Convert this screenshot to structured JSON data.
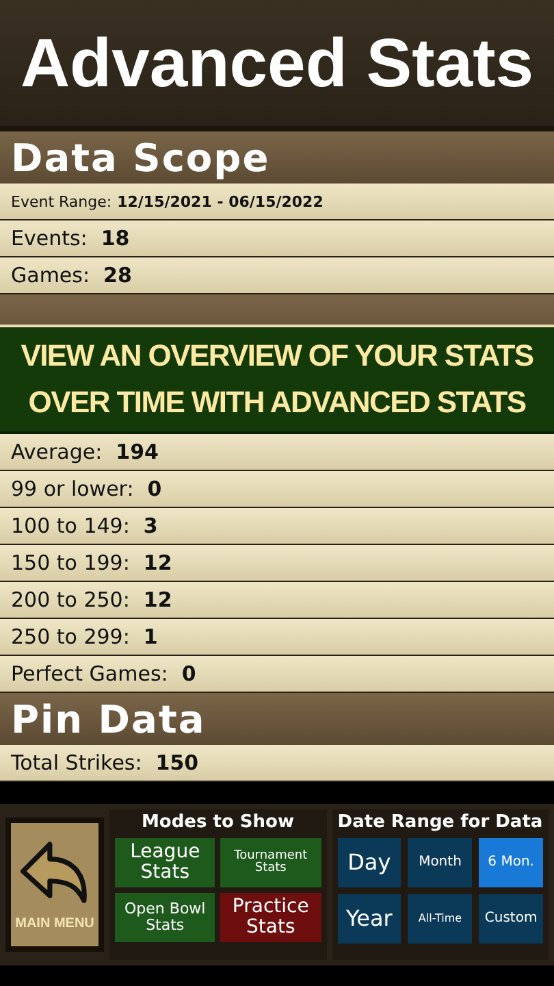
{
  "title": "Advanced Stats",
  "sections": [
    {
      "header": "Data Scope",
      "rows": [
        {
          "label": "Event Range:",
          "value": "12/15/2021 - 06/15/2022",
          "kind": "small"
        },
        {
          "label": "Events:",
          "value": "18",
          "kind": "normal"
        },
        {
          "label": "Games:",
          "value": "28",
          "kind": "normal"
        }
      ]
    },
    {
      "rows": [
        {
          "label": "Average:",
          "value": "194",
          "kind": "normal"
        },
        {
          "label": "99 or lower:",
          "value": "0",
          "kind": "normal"
        },
        {
          "label": "100 to 149:",
          "value": "3",
          "kind": "normal"
        },
        {
          "label": "150 to 199:",
          "value": "12",
          "kind": "normal"
        },
        {
          "label": "200 to 250:",
          "value": "12",
          "kind": "normal"
        },
        {
          "label": "250 to 299:",
          "value": "1",
          "kind": "normal"
        },
        {
          "label": "Perfect Games:",
          "value": "0",
          "kind": "normal"
        }
      ]
    },
    {
      "header": "Pin Data",
      "rows": [
        {
          "label": "Total Strikes:",
          "value": "150",
          "kind": "normal"
        }
      ]
    }
  ],
  "banner": [
    "VIEW AN OVERVIEW OF YOUR STATS",
    "OVER TIME WITH ADVANCED STATS"
  ],
  "main_menu": {
    "label": "MAIN MENU"
  },
  "modes": {
    "title": "Modes to Show",
    "items": [
      {
        "label": "League Stats",
        "on": true,
        "kind": "large"
      },
      {
        "label": "Tournament Stats",
        "on": true,
        "kind": "small"
      },
      {
        "label": "Open Bowl Stats",
        "on": true,
        "kind": "medium"
      },
      {
        "label": "Practice Stats",
        "on": false,
        "kind": "large"
      }
    ]
  },
  "date_range": {
    "title": "Date Range for Data",
    "items": [
      {
        "label": "Day",
        "selected": false,
        "kind": "large"
      },
      {
        "label": "Month",
        "selected": false,
        "kind": "small"
      },
      {
        "label": "6 Mon.",
        "selected": true,
        "kind": "small"
      },
      {
        "label": "Year",
        "selected": false,
        "kind": "large"
      },
      {
        "label": "All-Time",
        "selected": false,
        "kind": "tiny"
      },
      {
        "label": "Custom",
        "selected": false,
        "kind": "small"
      }
    ]
  }
}
